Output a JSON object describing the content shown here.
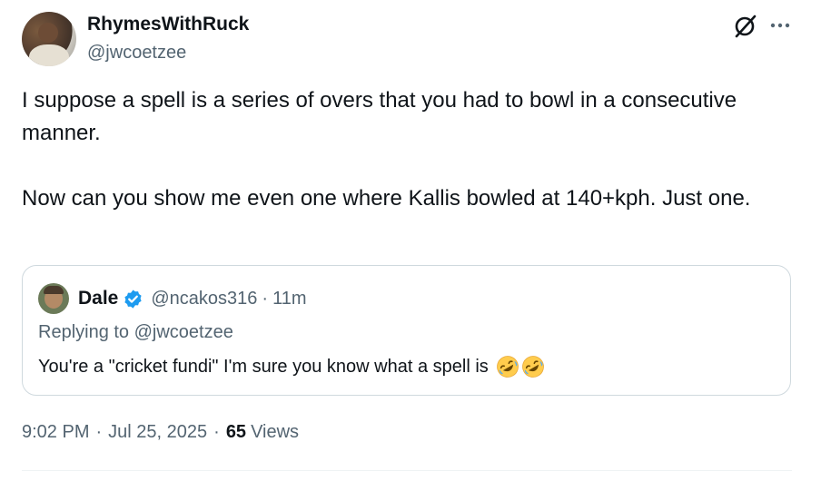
{
  "author": {
    "display_name": "RhymesWithRuck",
    "handle": "@jwcoetzee"
  },
  "tweet": {
    "paragraphs": [
      "I suppose a spell is a series of overs that you had to bowl in a consecutive manner.",
      "Now can you show me even one where Kallis bowled at 140+kph. Just one."
    ]
  },
  "header_actions": {
    "grok_icon": "grok-icon",
    "more_icon": "more-icon"
  },
  "quote": {
    "display_name": "Dale",
    "verified": true,
    "handle": "@ncakos316",
    "dot": "·",
    "time": "11m",
    "replying_to": "Replying to @jwcoetzee",
    "text": "You're a \"cricket fundi\" I'm sure you know what a spell is",
    "emojis": [
      "rolling-on-floor-laughing-icon",
      "rolling-on-floor-laughing-icon"
    ]
  },
  "meta": {
    "time": "9:02 PM",
    "sep1": "·",
    "date": "Jul 25, 2025",
    "sep2": "·",
    "views_count": "65",
    "views_label": "Views"
  },
  "colors": {
    "text_primary": "#0f1419",
    "text_secondary": "#536471",
    "border": "#cfd9de",
    "verified_blue": "#1d9bf0",
    "emoji_yellow": "#ffcc4d"
  }
}
